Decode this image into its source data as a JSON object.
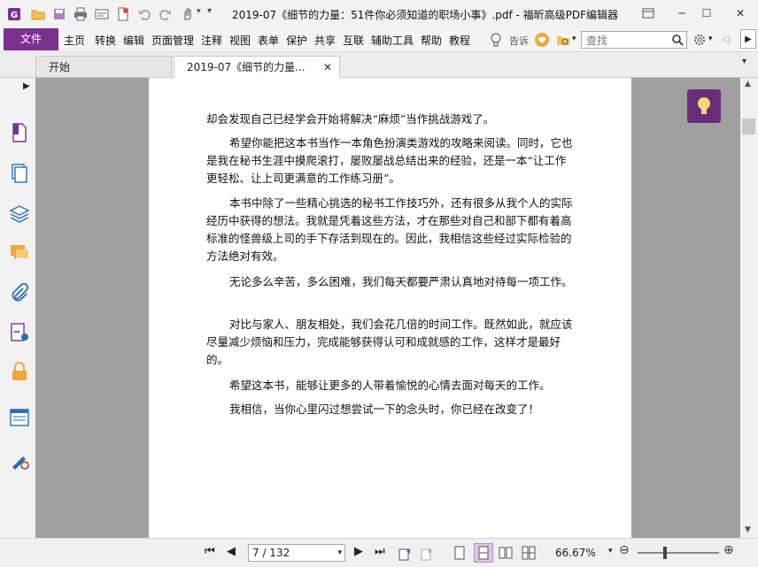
{
  "window": {
    "title": "2019-07《细节的力量：51件你必须知道的职场小事》.pdf - 福昕高级PDF编辑器"
  },
  "menu": {
    "file": "文件",
    "items": [
      "主页",
      "转换",
      "编辑",
      "页面管理",
      "注释",
      "视图",
      "表单",
      "保护",
      "共享",
      "互联",
      "辅助工具",
      "帮助",
      "教程"
    ],
    "tell": "告诉"
  },
  "search": {
    "placeholder": "查找"
  },
  "tabs": [
    {
      "label": "开始"
    },
    {
      "label": "2019-07《细节的力量..."
    }
  ],
  "document": {
    "paragraphs": [
      "却会发现自己已经学会开始将解决“麻烦”当作挑战游戏了。",
      "希望你能把这本书当作一本角色扮演类游戏的攻略来阅读。同时，它也是我在秘书生涯中摸爬滚打，屡败屡战总结出来的经验，还是一本“让工作更轻松、让上司更满意的工作练习册”。",
      "本书中除了一些精心挑选的秘书工作技巧外，还有很多从我个人的实际经历中获得的想法。我就是凭着这些方法，才在那些对自己和部下都有着高标准的怪兽级上司的手下存活到现在的。因此，我相信这些经过实际检验的方法绝对有效。",
      "无论多么辛苦，多么困难，我们每天都要严肃认真地对待每一项工作。",
      "对比与家人、朋友相处，我们会花几倍的时间工作。既然如此，就应该尽量减少烦恼和压力，完成能够获得认可和成就感的工作，这样才是最好的。",
      "希望这本书，能够让更多的人带着愉悦的心情去面对每天的工作。",
      "我相信，当你心里闪过想尝试一下的念头时，你已经在改变了！"
    ]
  },
  "status": {
    "page_display": "7 / 132",
    "zoom": "66.67%"
  },
  "colors": {
    "accent": "#7b3090",
    "lamp_bg": "#6b2c78",
    "doc_bg": "#a0a0a0"
  }
}
